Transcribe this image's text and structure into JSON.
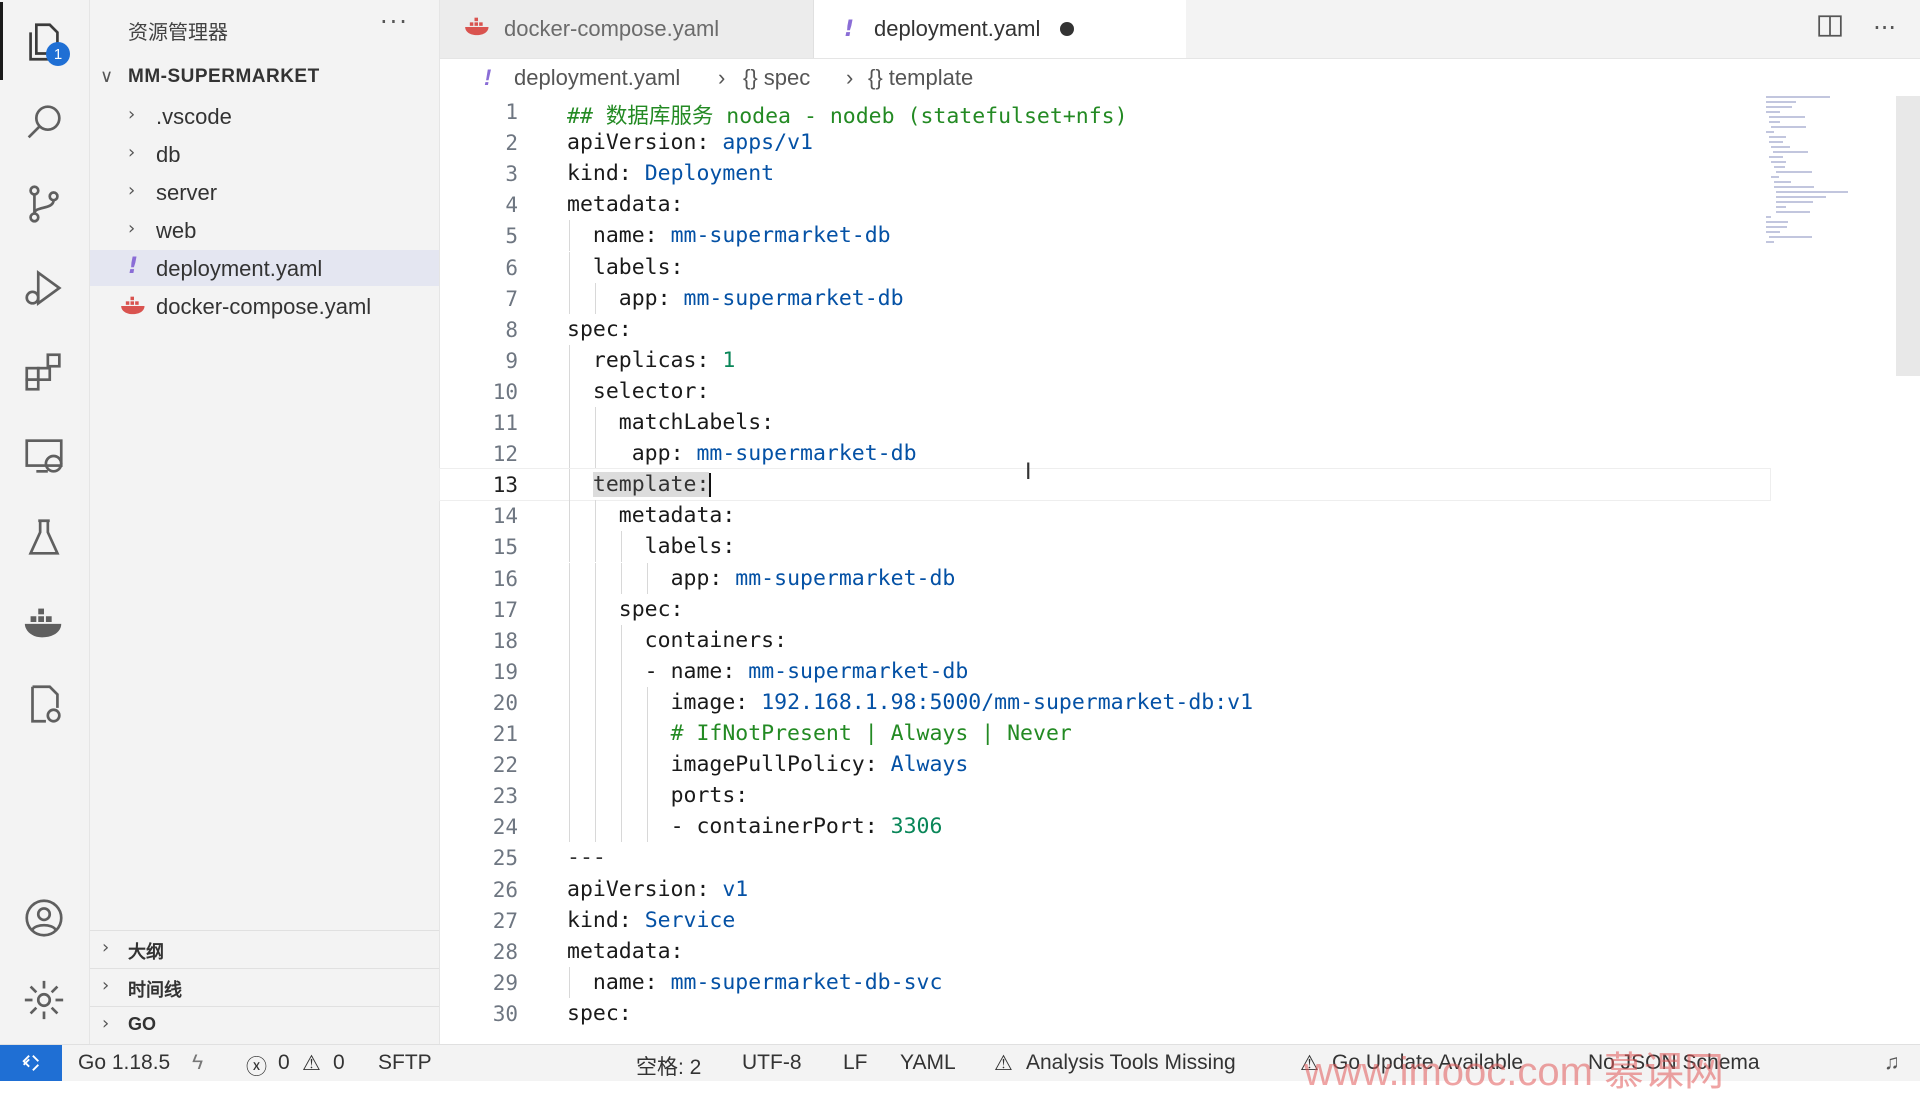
{
  "sidebar": {
    "title": "资源管理器",
    "more": "···",
    "project": "MM-SUPERMARKET",
    "items": [
      {
        "label": ".vscode",
        "type": "folder"
      },
      {
        "label": "db",
        "type": "folder"
      },
      {
        "label": "server",
        "type": "folder"
      },
      {
        "label": "web",
        "type": "folder"
      },
      {
        "label": "deployment.yaml",
        "type": "yaml"
      },
      {
        "label": "docker-compose.yaml",
        "type": "docker"
      }
    ],
    "bottom_sections": [
      "大纲",
      "时间线",
      "GO"
    ]
  },
  "activity": {
    "badge": "1"
  },
  "tabs": [
    {
      "label": "docker-compose.yaml",
      "active": false
    },
    {
      "label": "deployment.yaml",
      "active": true,
      "modified": true
    }
  ],
  "breadcrumb": [
    "deployment.yaml",
    "{} spec",
    "{} template"
  ],
  "editor": {
    "lines": [
      "## 数据库服务 nodea - nodeb (statefulset+nfs)",
      "apiVersion: apps/v1",
      "kind: Deployment",
      "metadata:",
      "  name: mm-supermarket-db",
      "  labels:",
      "    app: mm-supermarket-db",
      "spec:",
      "  replicas: 1",
      "  selector:",
      "    matchLabels:",
      "     app: mm-supermarket-db",
      "  template:",
      "    metadata:",
      "      labels:",
      "        app: mm-supermarket-db",
      "    spec:",
      "      containers:",
      "      - name: mm-supermarket-db",
      "        image: 192.168.1.98:5000/mm-supermarket-db:v1",
      "        # IfNotPresent | Always | Never",
      "        imagePullPolicy: Always",
      "        ports:",
      "        - containerPort: 3306",
      "---",
      "apiVersion: v1",
      "kind: Service",
      "metadata:",
      "  name: mm-supermarket-db-svc",
      "spec:"
    ],
    "current_line": 13
  },
  "status": {
    "go_version": "Go 1.18.5",
    "errors": "0",
    "warnings": "0",
    "sftp": "SFTP",
    "indent": "空格: 2",
    "encoding": "UTF-8",
    "eol": "LF",
    "language": "YAML",
    "analysis": "Analysis Tools Missing",
    "go_update": "Go Update Available",
    "schema": "No JSON Schema"
  },
  "watermark": "www.imooc.com   慕课网",
  "colors": {
    "accent": "#1f6fd4",
    "comment": "#238a23",
    "value": "#0451a5",
    "number": "#098658"
  }
}
